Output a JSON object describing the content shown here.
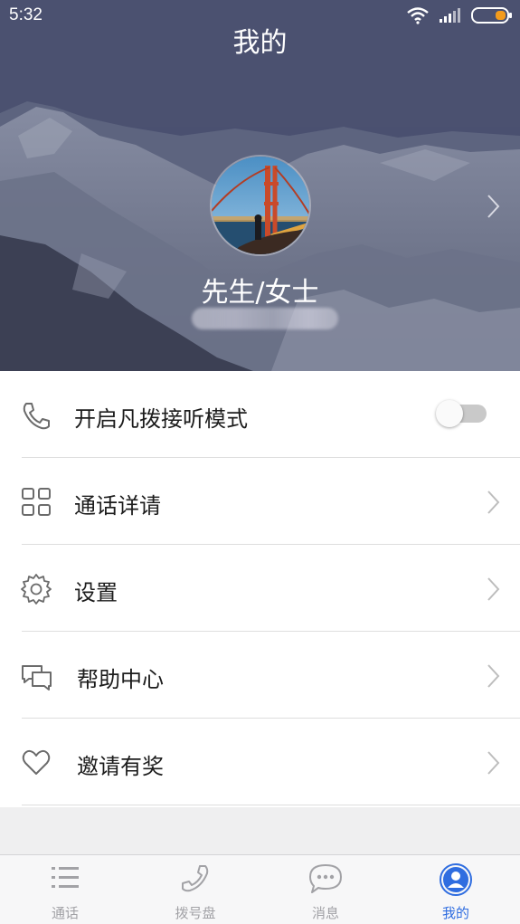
{
  "status_bar": {
    "time": "5:32"
  },
  "header": {
    "title": "我的"
  },
  "profile": {
    "name": "先生/女士"
  },
  "menu": {
    "items": [
      {
        "label": "开启凡拨接听模式",
        "icon": "phone-icon",
        "control": "toggle",
        "toggle_on": false
      },
      {
        "label": "通话详请",
        "icon": "grid-icon",
        "control": "chevron"
      },
      {
        "label": "设置",
        "icon": "gear-icon",
        "control": "chevron"
      },
      {
        "label": "帮助中心",
        "icon": "chat-bubbles-icon",
        "control": "chevron"
      },
      {
        "label": "邀请有奖",
        "icon": "heart-icon",
        "control": "chevron"
      }
    ]
  },
  "tab_bar": {
    "tabs": [
      {
        "label": "通话",
        "icon": "list-icon",
        "active": false
      },
      {
        "label": "拨号盘",
        "icon": "phone-icon",
        "active": false
      },
      {
        "label": "消息",
        "icon": "message-icon",
        "active": false
      },
      {
        "label": "我的",
        "icon": "user-icon",
        "active": true
      }
    ]
  },
  "colors": {
    "accent": "#2f6de0",
    "inactive_tab": "#a2a2a6",
    "divider": "#dedede"
  }
}
